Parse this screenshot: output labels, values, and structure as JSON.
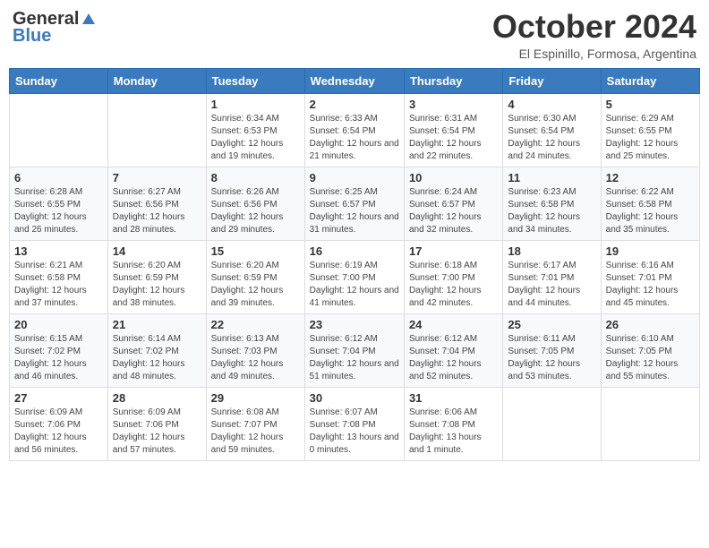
{
  "header": {
    "logo_general": "General",
    "logo_blue": "Blue",
    "month_title": "October 2024",
    "subtitle": "El Espinillo, Formosa, Argentina"
  },
  "days_of_week": [
    "Sunday",
    "Monday",
    "Tuesday",
    "Wednesday",
    "Thursday",
    "Friday",
    "Saturday"
  ],
  "weeks": [
    [
      {
        "day": "",
        "info": ""
      },
      {
        "day": "",
        "info": ""
      },
      {
        "day": "1",
        "info": "Sunrise: 6:34 AM\nSunset: 6:53 PM\nDaylight: 12 hours and 19 minutes."
      },
      {
        "day": "2",
        "info": "Sunrise: 6:33 AM\nSunset: 6:54 PM\nDaylight: 12 hours and 21 minutes."
      },
      {
        "day": "3",
        "info": "Sunrise: 6:31 AM\nSunset: 6:54 PM\nDaylight: 12 hours and 22 minutes."
      },
      {
        "day": "4",
        "info": "Sunrise: 6:30 AM\nSunset: 6:54 PM\nDaylight: 12 hours and 24 minutes."
      },
      {
        "day": "5",
        "info": "Sunrise: 6:29 AM\nSunset: 6:55 PM\nDaylight: 12 hours and 25 minutes."
      }
    ],
    [
      {
        "day": "6",
        "info": "Sunrise: 6:28 AM\nSunset: 6:55 PM\nDaylight: 12 hours and 26 minutes."
      },
      {
        "day": "7",
        "info": "Sunrise: 6:27 AM\nSunset: 6:56 PM\nDaylight: 12 hours and 28 minutes."
      },
      {
        "day": "8",
        "info": "Sunrise: 6:26 AM\nSunset: 6:56 PM\nDaylight: 12 hours and 29 minutes."
      },
      {
        "day": "9",
        "info": "Sunrise: 6:25 AM\nSunset: 6:57 PM\nDaylight: 12 hours and 31 minutes."
      },
      {
        "day": "10",
        "info": "Sunrise: 6:24 AM\nSunset: 6:57 PM\nDaylight: 12 hours and 32 minutes."
      },
      {
        "day": "11",
        "info": "Sunrise: 6:23 AM\nSunset: 6:58 PM\nDaylight: 12 hours and 34 minutes."
      },
      {
        "day": "12",
        "info": "Sunrise: 6:22 AM\nSunset: 6:58 PM\nDaylight: 12 hours and 35 minutes."
      }
    ],
    [
      {
        "day": "13",
        "info": "Sunrise: 6:21 AM\nSunset: 6:58 PM\nDaylight: 12 hours and 37 minutes."
      },
      {
        "day": "14",
        "info": "Sunrise: 6:20 AM\nSunset: 6:59 PM\nDaylight: 12 hours and 38 minutes."
      },
      {
        "day": "15",
        "info": "Sunrise: 6:20 AM\nSunset: 6:59 PM\nDaylight: 12 hours and 39 minutes."
      },
      {
        "day": "16",
        "info": "Sunrise: 6:19 AM\nSunset: 7:00 PM\nDaylight: 12 hours and 41 minutes."
      },
      {
        "day": "17",
        "info": "Sunrise: 6:18 AM\nSunset: 7:00 PM\nDaylight: 12 hours and 42 minutes."
      },
      {
        "day": "18",
        "info": "Sunrise: 6:17 AM\nSunset: 7:01 PM\nDaylight: 12 hours and 44 minutes."
      },
      {
        "day": "19",
        "info": "Sunrise: 6:16 AM\nSunset: 7:01 PM\nDaylight: 12 hours and 45 minutes."
      }
    ],
    [
      {
        "day": "20",
        "info": "Sunrise: 6:15 AM\nSunset: 7:02 PM\nDaylight: 12 hours and 46 minutes."
      },
      {
        "day": "21",
        "info": "Sunrise: 6:14 AM\nSunset: 7:02 PM\nDaylight: 12 hours and 48 minutes."
      },
      {
        "day": "22",
        "info": "Sunrise: 6:13 AM\nSunset: 7:03 PM\nDaylight: 12 hours and 49 minutes."
      },
      {
        "day": "23",
        "info": "Sunrise: 6:12 AM\nSunset: 7:04 PM\nDaylight: 12 hours and 51 minutes."
      },
      {
        "day": "24",
        "info": "Sunrise: 6:12 AM\nSunset: 7:04 PM\nDaylight: 12 hours and 52 minutes."
      },
      {
        "day": "25",
        "info": "Sunrise: 6:11 AM\nSunset: 7:05 PM\nDaylight: 12 hours and 53 minutes."
      },
      {
        "day": "26",
        "info": "Sunrise: 6:10 AM\nSunset: 7:05 PM\nDaylight: 12 hours and 55 minutes."
      }
    ],
    [
      {
        "day": "27",
        "info": "Sunrise: 6:09 AM\nSunset: 7:06 PM\nDaylight: 12 hours and 56 minutes."
      },
      {
        "day": "28",
        "info": "Sunrise: 6:09 AM\nSunset: 7:06 PM\nDaylight: 12 hours and 57 minutes."
      },
      {
        "day": "29",
        "info": "Sunrise: 6:08 AM\nSunset: 7:07 PM\nDaylight: 12 hours and 59 minutes."
      },
      {
        "day": "30",
        "info": "Sunrise: 6:07 AM\nSunset: 7:08 PM\nDaylight: 13 hours and 0 minutes."
      },
      {
        "day": "31",
        "info": "Sunrise: 6:06 AM\nSunset: 7:08 PM\nDaylight: 13 hours and 1 minute."
      },
      {
        "day": "",
        "info": ""
      },
      {
        "day": "",
        "info": ""
      }
    ]
  ]
}
